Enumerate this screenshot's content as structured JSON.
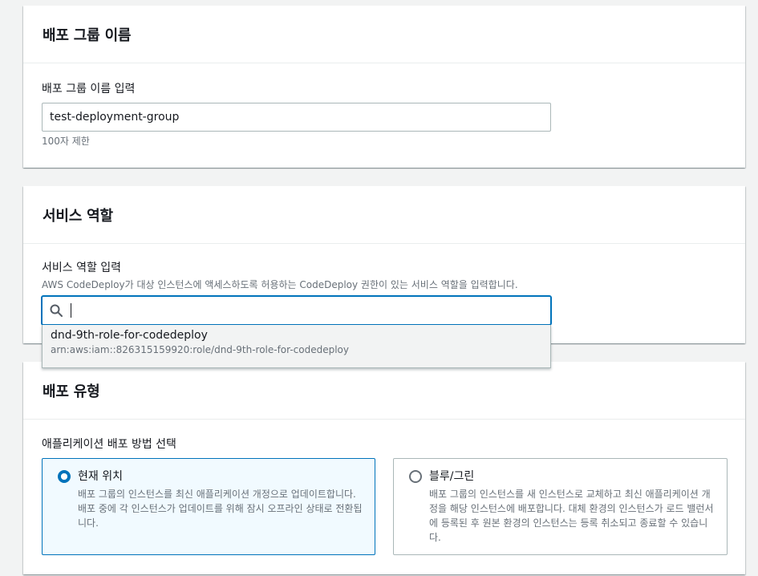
{
  "group_name_section": {
    "title": "배포 그룹 이름",
    "input_label": "배포 그룹 이름 입력",
    "input_value": "test-deployment-group",
    "constraint": "100자 제한"
  },
  "service_role_section": {
    "title": "서비스 역할",
    "input_label": "서비스 역할 입력",
    "description": "AWS CodeDeploy가 대상 인스턴스에 액세스하도록 허용하는 CodeDeploy 권한이 있는 서비스 역할을 입력합니다.",
    "search_value": "",
    "search_icon": "search-icon",
    "options": [
      {
        "label": "dnd-9th-role-for-codedeploy",
        "arn": "arn:aws:iam::826315159920:role/dnd-9th-role-for-codedeploy"
      }
    ]
  },
  "deployment_type_section": {
    "title": "배포 유형",
    "input_label": "애플리케이션 배포 방법 선택",
    "options": [
      {
        "title": "현재 위치",
        "description": "배포 그룹의 인스턴스를 최신 애플리케이션 개정으로 업데이트합니다. 배포 중에 각 인스턴스가 업데이트를 위해 잠시 오프라인 상태로 전환됩니다.",
        "selected": true
      },
      {
        "title": "블루/그린",
        "description": "배포 그룹의 인스턴스를 새 인스턴스로 교체하고 최신 애플리케이션 개정을 해당 인스턴스에 배포합니다. 대체 환경의 인스턴스가 로드 밸런서에 등록된 후 원본 환경의 인스턴스는 등록 취소되고 종료할 수 있습니다.",
        "selected": false
      }
    ]
  },
  "colors": {
    "accent": "#0073bb",
    "selected_bg": "#f1faff",
    "border": "#aab7b8",
    "muted_text": "#687078"
  }
}
